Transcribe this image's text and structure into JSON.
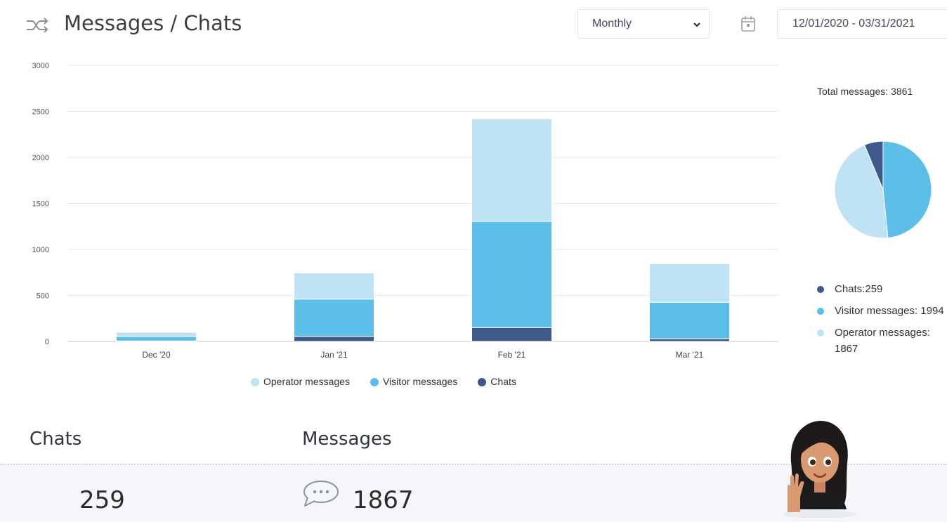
{
  "header": {
    "title": "Messages / Chats",
    "title_icon": "shuffle-icon",
    "period_select": {
      "value": "Monthly",
      "icon": "chevron-down-icon"
    },
    "calendar_icon": "calendar-icon",
    "date_range": "12/01/2020 - 03/31/2021"
  },
  "chart_data": [
    {
      "type": "bar",
      "stacked": true,
      "categories": [
        "Dec '20",
        "Jan '21",
        "Feb '21",
        "Mar '21"
      ],
      "yticks": [
        "0",
        "500",
        "1000",
        "1500",
        "2000",
        "2500",
        "3000"
      ],
      "ylim": [
        0,
        3000
      ],
      "grid": true,
      "series": [
        {
          "name": "Chats",
          "color": "#3d5a8a",
          "values": [
            5,
            55,
            150,
            30
          ]
        },
        {
          "name": "Visitor messages",
          "color": "#5cbfe8",
          "values": [
            50,
            405,
            1155,
            395
          ]
        },
        {
          "name": "Operator messages",
          "color": "#bfe3f5",
          "values": [
            45,
            285,
            1115,
            420
          ]
        }
      ],
      "legend": {
        "placement": "bottom",
        "items": [
          {
            "label": "Operator messages",
            "color": "#bfe3f5"
          },
          {
            "label": "Visitor messages",
            "color": "#5cbfe8"
          },
          {
            "label": "Chats",
            "color": "#3d5a8a"
          }
        ]
      }
    },
    {
      "type": "pie",
      "title": "Total messages: 3861",
      "slices": [
        {
          "name": "Chats",
          "value": 259,
          "color": "#3d5a8a"
        },
        {
          "name": "Visitor messages",
          "value": 1994,
          "color": "#5cbfe8"
        },
        {
          "name": "Operator messages",
          "value": 1867,
          "color": "#bfe3f5"
        }
      ],
      "legend": {
        "placement": "bottom",
        "items": [
          {
            "label": "Chats:259",
            "color": "#3d5a8a"
          },
          {
            "label": "Visitor messages: 1994",
            "color": "#5cbfe8"
          },
          {
            "label": "Operator messages: 1867",
            "color": "#bfe3f5"
          }
        ]
      }
    }
  ],
  "stats": {
    "chats": {
      "label": "Chats",
      "value": "259"
    },
    "messages": {
      "label": "Messages",
      "value": "1867",
      "icon": "chat-bubble-icon"
    }
  },
  "assistant": {
    "icon": "avatar-waving-icon"
  }
}
